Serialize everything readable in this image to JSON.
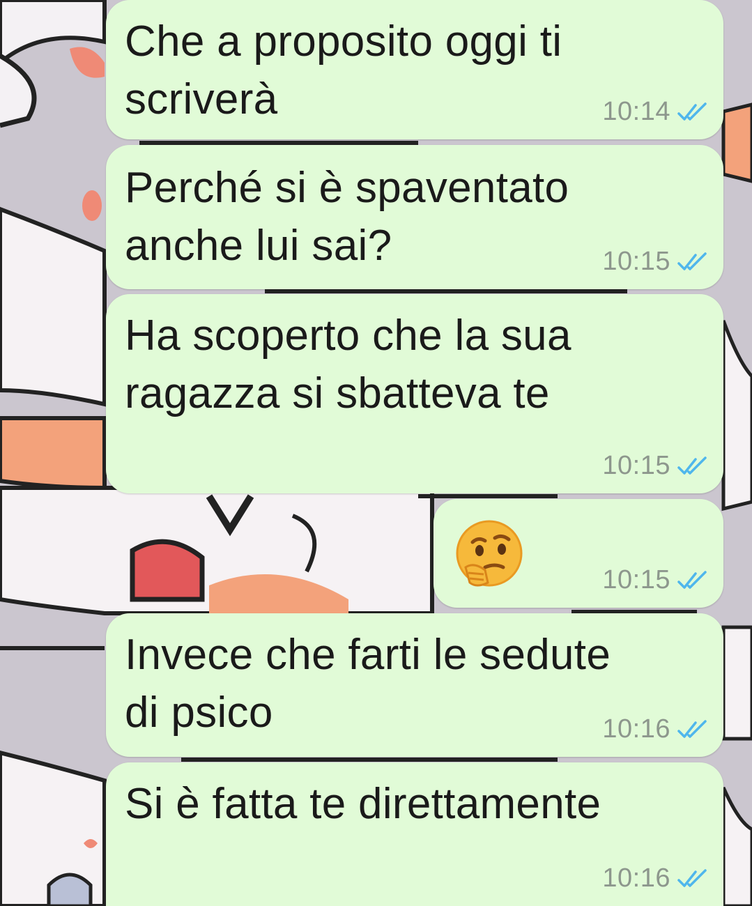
{
  "messages": [
    {
      "text": "Che a proposito oggi ti\nscriverà",
      "time": "10:14"
    },
    {
      "text": "Perché si è spaventato\nanche lui sai?",
      "time": "10:15"
    },
    {
      "text": "Ha scoperto che la sua\nragazza si sbatteva te",
      "time": "10:15"
    },
    {
      "emoji": "thinking-face",
      "time": "10:15"
    },
    {
      "text": "Invece che farti le sedute\ndi psico",
      "time": "10:16"
    },
    {
      "text": "Si è fatta te direttamente",
      "time": "10:16"
    }
  ],
  "colors": {
    "bubble": "#e1fbd7",
    "read_ticks": "#4fb6ec",
    "time": "#8d978d"
  }
}
